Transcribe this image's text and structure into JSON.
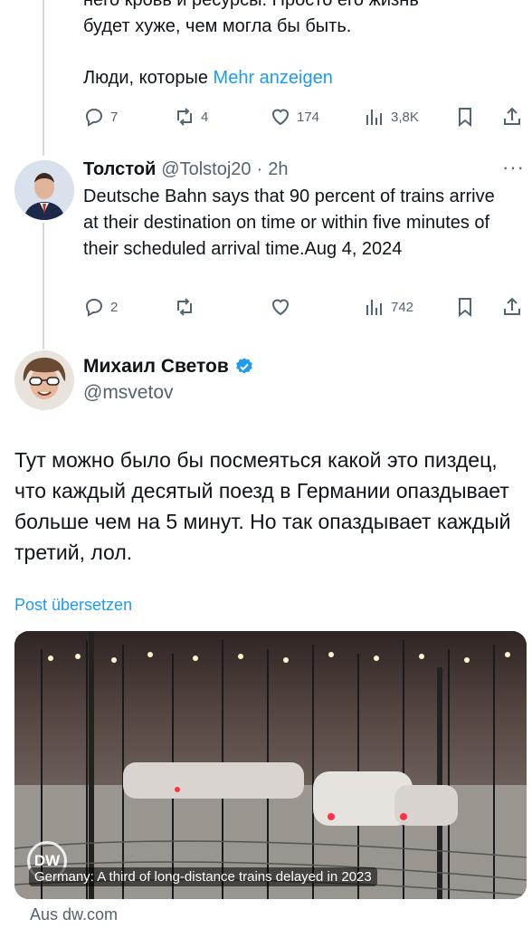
{
  "top_tweet": {
    "line1": "него кровь и ресурсы. Просто его жизнь",
    "line2": "будет хуже, чем могла бы быть.",
    "line3": "Люди, которые",
    "more_link": "Mehr anzeigen",
    "actions": {
      "replies": "7",
      "reposts": "4",
      "likes": "174",
      "views": "3,8K"
    }
  },
  "reply_tweet": {
    "name": "Толстой",
    "handle": "@Tolstoj20",
    "time": "2h",
    "text": "Deutsche Bahn says that 90 percent of trains arrive at their destination on time or within five minutes of their scheduled arrival time.Aug 4, 2024",
    "actions": {
      "replies": "2",
      "reposts": "",
      "likes": "",
      "views": "742"
    }
  },
  "main_tweet": {
    "name": "Михаил Светов",
    "handle": "@msvetov",
    "text": "Тут можно было бы посмеяться какой это пиздец, что каждый десятый поезд в Германии опаздывает больше чем на 5 минут. Но так опаздывает каждый третий, лол.",
    "translate": "Post übersetzen",
    "card": {
      "logo": "DW",
      "caption": "Germany: A third of long-distance trains delayed in 2023",
      "source": "Aus dw.com"
    }
  },
  "colors": {
    "link": "#1d9bf0",
    "secondary": "#536471",
    "verified": "#1d9bf0"
  }
}
